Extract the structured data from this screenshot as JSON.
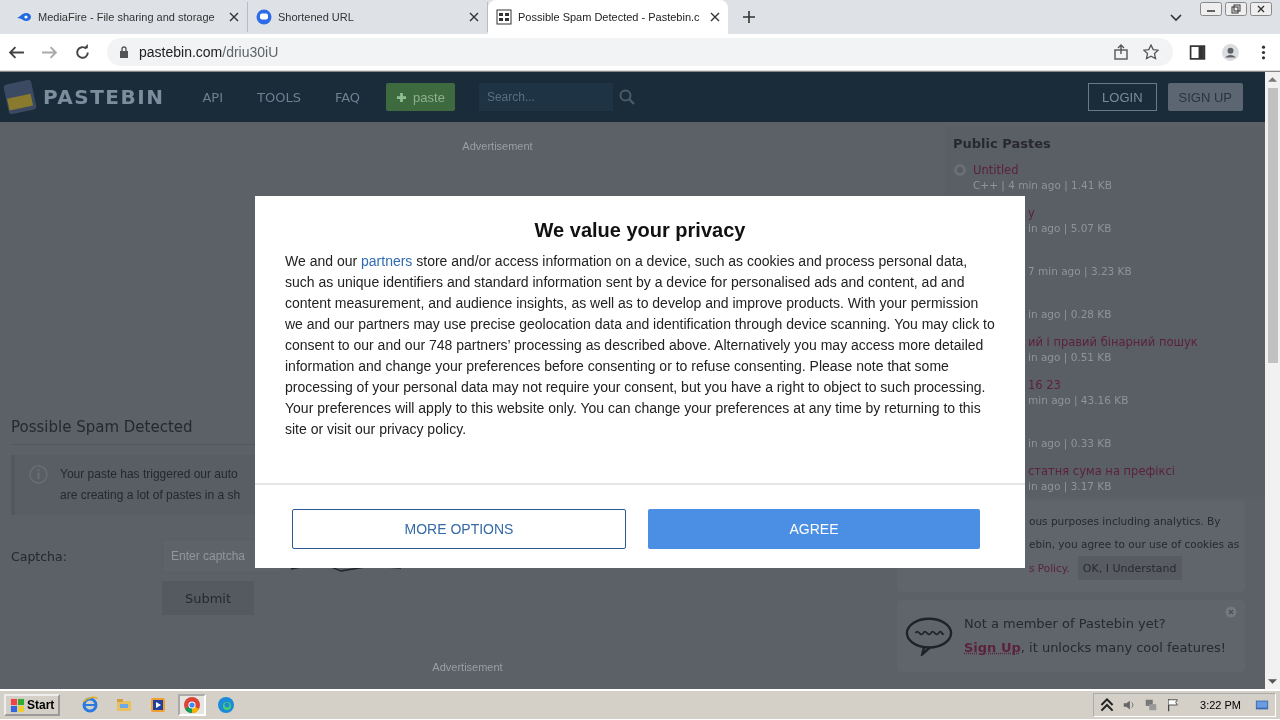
{
  "browser": {
    "tabs": [
      {
        "title": "MediaFire - File sharing and storage",
        "selected": false
      },
      {
        "title": "Shortened URL",
        "selected": false
      },
      {
        "title": "Possible Spam Detected - Pastebin.c",
        "selected": true
      }
    ],
    "url_host": "pastebin.com",
    "url_path": "/driu30iU"
  },
  "header": {
    "logo": "PASTEBIN",
    "nav": [
      "API",
      "TOOLS",
      "FAQ"
    ],
    "paste_button": "paste",
    "search_placeholder": "Search...",
    "login": "LOGIN",
    "signup": "SIGN UP"
  },
  "main": {
    "ad_top": "Advertisement",
    "title": "Possible Spam Detected",
    "notice_lines": [
      "Your paste has triggered our auto",
      "are creating a lot of pastes in a sh"
    ],
    "captcha_label": "Captcha:",
    "captcha_placeholder": "Enter captcha",
    "submit": "Submit",
    "ad_bottom": "Advertisement"
  },
  "sidebar": {
    "title": "Public Pastes",
    "pastes": [
      {
        "kind": "full",
        "title": "Untitled",
        "meta": "C++ | 4 min ago | 1.41 KB"
      },
      {
        "kind": "cut",
        "title": "y",
        "meta": "in ago | 5.07 KB"
      },
      {
        "kind": "cut",
        "meta": "7 min ago | 3.23 KB"
      },
      {
        "kind": "cut",
        "meta": "in ago | 0.28 KB"
      },
      {
        "kind": "cut",
        "title": "ий і правий бінарний пошук",
        "meta": "in ago | 0.51 KB"
      },
      {
        "kind": "cut",
        "title": "16 23",
        "meta": "min ago | 43.16 KB"
      },
      {
        "kind": "cut",
        "meta": "in ago | 0.33 KB"
      },
      {
        "kind": "cut",
        "title": "статня сума на префіксі",
        "meta": "in ago | 3.17 KB"
      }
    ]
  },
  "cookie_notice": {
    "lines": [
      "ous purposes including analytics. By",
      "ebin, you agree to our use of cookies as"
    ],
    "link": "s Policy.",
    "button": "OK, I Understand"
  },
  "member_box": {
    "text": "Not a member of Pastebin yet?",
    "signup": "Sign Up",
    "after": ", it unlocks many cool features!"
  },
  "privacy_modal": {
    "title": "We value your privacy",
    "text_before": "We and our ",
    "link": "partners",
    "text_after": " store and/or access information on a device, such as cookies and process personal data, such as unique identifiers and standard information sent by a device for personalised ads and content, ad and content measurement, and audience insights, as well as to develop and improve products. With your permission we and our partners may use precise geolocation data and identification through device scanning. You may click to consent to our and our 748 partners’ processing as described above. Alternatively you may access more detailed information and change your preferences before consenting or to refuse consenting. Please note that some processing of your personal data may not require your consent, but you have a right to object to such processing. Your preferences will apply to this website only. You can change your preferences at any time by returning to this site or visit our privacy policy.",
    "more_options": "MORE OPTIONS",
    "agree": "AGREE"
  },
  "taskbar": {
    "start": "Start",
    "apps": [
      {
        "selected": false
      },
      {
        "selected": false
      },
      {
        "selected": false
      },
      {
        "selected": true
      },
      {
        "selected": false
      }
    ],
    "clock": "3:22 PM"
  }
}
